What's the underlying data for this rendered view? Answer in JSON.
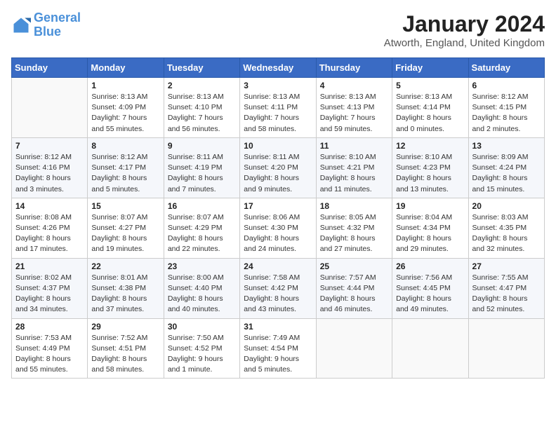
{
  "logo": {
    "line1": "General",
    "line2": "Blue"
  },
  "title": "January 2024",
  "subtitle": "Atworth, England, United Kingdom",
  "days_of_week": [
    "Sunday",
    "Monday",
    "Tuesday",
    "Wednesday",
    "Thursday",
    "Friday",
    "Saturday"
  ],
  "weeks": [
    [
      {
        "num": "",
        "detail": ""
      },
      {
        "num": "1",
        "detail": "Sunrise: 8:13 AM\nSunset: 4:09 PM\nDaylight: 7 hours\nand 55 minutes."
      },
      {
        "num": "2",
        "detail": "Sunrise: 8:13 AM\nSunset: 4:10 PM\nDaylight: 7 hours\nand 56 minutes."
      },
      {
        "num": "3",
        "detail": "Sunrise: 8:13 AM\nSunset: 4:11 PM\nDaylight: 7 hours\nand 58 minutes."
      },
      {
        "num": "4",
        "detail": "Sunrise: 8:13 AM\nSunset: 4:13 PM\nDaylight: 7 hours\nand 59 minutes."
      },
      {
        "num": "5",
        "detail": "Sunrise: 8:13 AM\nSunset: 4:14 PM\nDaylight: 8 hours\nand 0 minutes."
      },
      {
        "num": "6",
        "detail": "Sunrise: 8:12 AM\nSunset: 4:15 PM\nDaylight: 8 hours\nand 2 minutes."
      }
    ],
    [
      {
        "num": "7",
        "detail": "Sunrise: 8:12 AM\nSunset: 4:16 PM\nDaylight: 8 hours\nand 3 minutes."
      },
      {
        "num": "8",
        "detail": "Sunrise: 8:12 AM\nSunset: 4:17 PM\nDaylight: 8 hours\nand 5 minutes."
      },
      {
        "num": "9",
        "detail": "Sunrise: 8:11 AM\nSunset: 4:19 PM\nDaylight: 8 hours\nand 7 minutes."
      },
      {
        "num": "10",
        "detail": "Sunrise: 8:11 AM\nSunset: 4:20 PM\nDaylight: 8 hours\nand 9 minutes."
      },
      {
        "num": "11",
        "detail": "Sunrise: 8:10 AM\nSunset: 4:21 PM\nDaylight: 8 hours\nand 11 minutes."
      },
      {
        "num": "12",
        "detail": "Sunrise: 8:10 AM\nSunset: 4:23 PM\nDaylight: 8 hours\nand 13 minutes."
      },
      {
        "num": "13",
        "detail": "Sunrise: 8:09 AM\nSunset: 4:24 PM\nDaylight: 8 hours\nand 15 minutes."
      }
    ],
    [
      {
        "num": "14",
        "detail": "Sunrise: 8:08 AM\nSunset: 4:26 PM\nDaylight: 8 hours\nand 17 minutes."
      },
      {
        "num": "15",
        "detail": "Sunrise: 8:07 AM\nSunset: 4:27 PM\nDaylight: 8 hours\nand 19 minutes."
      },
      {
        "num": "16",
        "detail": "Sunrise: 8:07 AM\nSunset: 4:29 PM\nDaylight: 8 hours\nand 22 minutes."
      },
      {
        "num": "17",
        "detail": "Sunrise: 8:06 AM\nSunset: 4:30 PM\nDaylight: 8 hours\nand 24 minutes."
      },
      {
        "num": "18",
        "detail": "Sunrise: 8:05 AM\nSunset: 4:32 PM\nDaylight: 8 hours\nand 27 minutes."
      },
      {
        "num": "19",
        "detail": "Sunrise: 8:04 AM\nSunset: 4:34 PM\nDaylight: 8 hours\nand 29 minutes."
      },
      {
        "num": "20",
        "detail": "Sunrise: 8:03 AM\nSunset: 4:35 PM\nDaylight: 8 hours\nand 32 minutes."
      }
    ],
    [
      {
        "num": "21",
        "detail": "Sunrise: 8:02 AM\nSunset: 4:37 PM\nDaylight: 8 hours\nand 34 minutes."
      },
      {
        "num": "22",
        "detail": "Sunrise: 8:01 AM\nSunset: 4:38 PM\nDaylight: 8 hours\nand 37 minutes."
      },
      {
        "num": "23",
        "detail": "Sunrise: 8:00 AM\nSunset: 4:40 PM\nDaylight: 8 hours\nand 40 minutes."
      },
      {
        "num": "24",
        "detail": "Sunrise: 7:58 AM\nSunset: 4:42 PM\nDaylight: 8 hours\nand 43 minutes."
      },
      {
        "num": "25",
        "detail": "Sunrise: 7:57 AM\nSunset: 4:44 PM\nDaylight: 8 hours\nand 46 minutes."
      },
      {
        "num": "26",
        "detail": "Sunrise: 7:56 AM\nSunset: 4:45 PM\nDaylight: 8 hours\nand 49 minutes."
      },
      {
        "num": "27",
        "detail": "Sunrise: 7:55 AM\nSunset: 4:47 PM\nDaylight: 8 hours\nand 52 minutes."
      }
    ],
    [
      {
        "num": "28",
        "detail": "Sunrise: 7:53 AM\nSunset: 4:49 PM\nDaylight: 8 hours\nand 55 minutes."
      },
      {
        "num": "29",
        "detail": "Sunrise: 7:52 AM\nSunset: 4:51 PM\nDaylight: 8 hours\nand 58 minutes."
      },
      {
        "num": "30",
        "detail": "Sunrise: 7:50 AM\nSunset: 4:52 PM\nDaylight: 9 hours\nand 1 minute."
      },
      {
        "num": "31",
        "detail": "Sunrise: 7:49 AM\nSunset: 4:54 PM\nDaylight: 9 hours\nand 5 minutes."
      },
      {
        "num": "",
        "detail": ""
      },
      {
        "num": "",
        "detail": ""
      },
      {
        "num": "",
        "detail": ""
      }
    ]
  ]
}
